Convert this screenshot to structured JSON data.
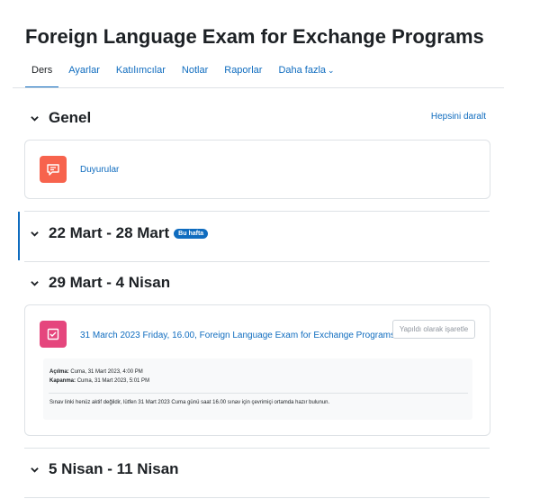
{
  "course": {
    "title": "Foreign Language Exam for Exchange Programs"
  },
  "nav": {
    "tabs": [
      "Ders",
      "Ayarlar",
      "Katılımcılar",
      "Notlar",
      "Raporlar",
      "Daha fazla"
    ],
    "active_tab": "Ders"
  },
  "actions": {
    "collapse_all": "Hepsini daralt"
  },
  "sections": {
    "general": {
      "title": "Genel",
      "activity": {
        "name": "Duyurular",
        "icon": "forum-icon",
        "color": "#f7634d"
      }
    },
    "week1": {
      "title": "22 Mart - 28 Mart",
      "badge": "Bu hafta",
      "current": true
    },
    "week2": {
      "title": "29 Mart - 4 Nisan",
      "activity": {
        "name": "31 March 2023 Friday, 16.00, Foreign Language Exam for Exchange Programs",
        "icon": "quiz-icon",
        "color": "#e5467d",
        "mark_done": "Yapıldı olarak işaretle",
        "open_label": "Açılma:",
        "open_value": "Cuma, 31 Mart 2023, 4:00 PM",
        "close_label": "Kapanma:",
        "close_value": "Cuma, 31 Mart 2023, 5:01 PM",
        "note": "Sınav linki henüz aktif değildir, lütfen 31 Mart 2023 Cuma günü saat 16.00 sınav için çevrimiçi ortamda hazır bulunun."
      }
    },
    "week3": {
      "title": "5 Nisan - 11 Nisan"
    }
  },
  "colors": {
    "accent": "#0f6cbf",
    "text": "#1d2125",
    "border": "#dee2e6"
  }
}
